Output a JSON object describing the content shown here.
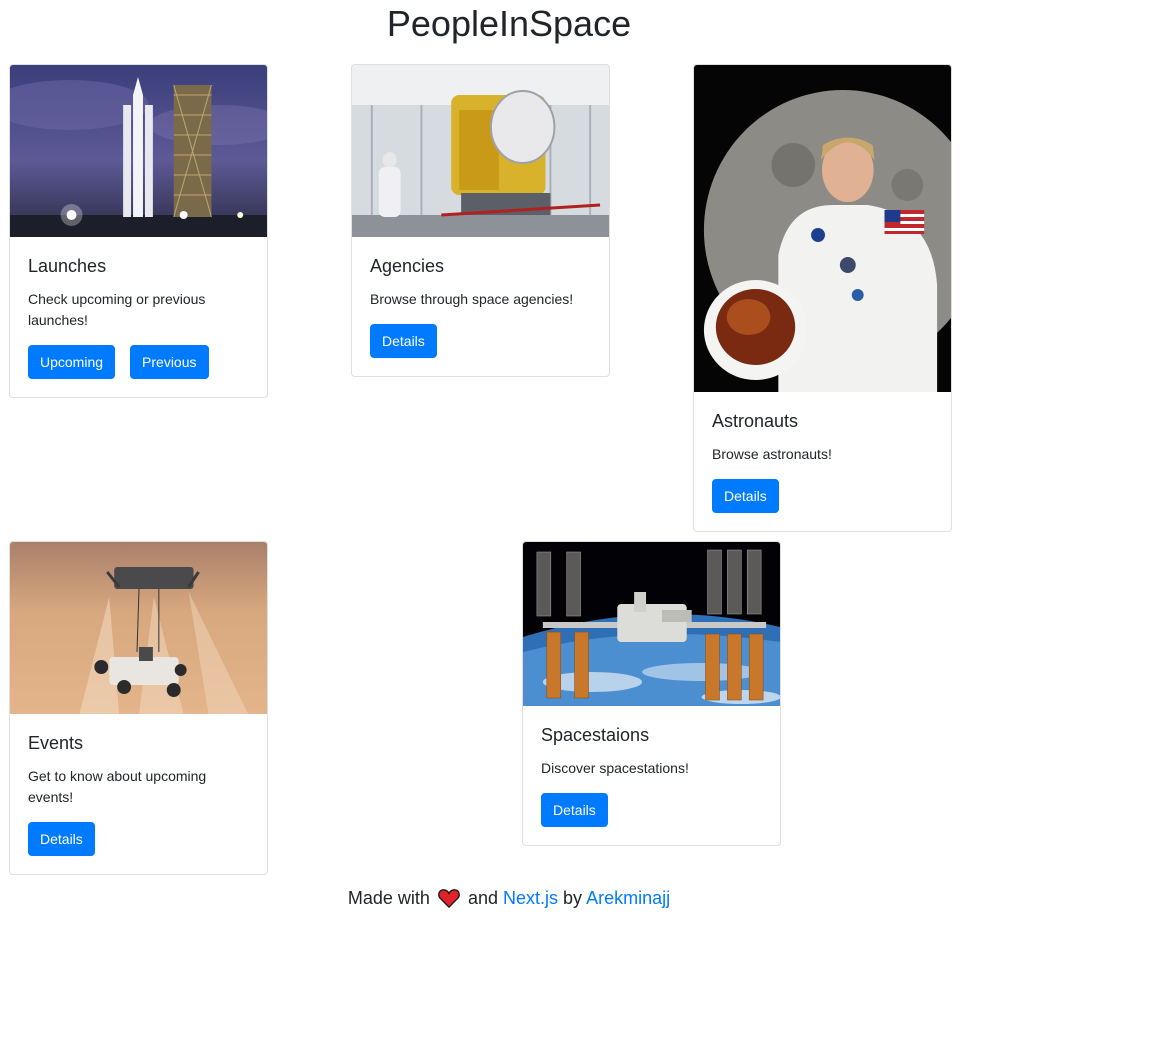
{
  "site": {
    "title": "PeopleInSpace"
  },
  "cards": {
    "launches": {
      "title": "Launches",
      "text": "Check upcoming or previous launches!",
      "buttons": {
        "upcoming": "Upcoming",
        "previous": "Previous"
      }
    },
    "agencies": {
      "title": "Agencies",
      "text": "Browse through space agencies!",
      "button": "Details"
    },
    "astronauts": {
      "title": "Astronauts",
      "text": "Browse astronauts!",
      "button": "Details"
    },
    "events": {
      "title": "Events",
      "text": "Get to know about upcoming events!",
      "button": "Details"
    },
    "spacestations": {
      "title": "Spacestaions",
      "text": "Discover spacestations!",
      "button": "Details"
    }
  },
  "footer": {
    "made_with": "Made with",
    "and": "and",
    "framework_link": "Next.js",
    "by": "by",
    "author_link": "Arekminajj",
    "heart_icon": "heart-icon"
  },
  "colors": {
    "primary": "#007bff",
    "text": "#212529",
    "heart": "#e0222a"
  }
}
